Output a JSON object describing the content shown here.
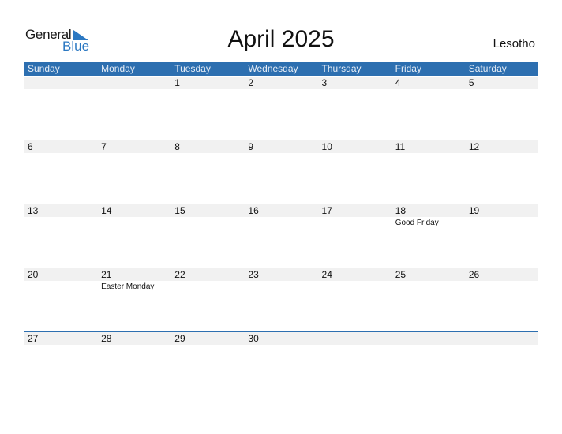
{
  "logo": {
    "line1": "General",
    "line2": "Blue"
  },
  "title": "April 2025",
  "country": "Lesotho",
  "colors": {
    "accent": "#2d6fb0",
    "strip": "#f1f1f1",
    "logo_blue": "#2b78c2"
  },
  "weekdays": [
    "Sunday",
    "Monday",
    "Tuesday",
    "Wednesday",
    "Thursday",
    "Friday",
    "Saturday"
  ],
  "weeks": [
    [
      {
        "d": ""
      },
      {
        "d": ""
      },
      {
        "d": "1"
      },
      {
        "d": "2"
      },
      {
        "d": "3"
      },
      {
        "d": "4"
      },
      {
        "d": "5"
      }
    ],
    [
      {
        "d": "6"
      },
      {
        "d": "7"
      },
      {
        "d": "8"
      },
      {
        "d": "9"
      },
      {
        "d": "10"
      },
      {
        "d": "11"
      },
      {
        "d": "12"
      }
    ],
    [
      {
        "d": "13"
      },
      {
        "d": "14"
      },
      {
        "d": "15"
      },
      {
        "d": "16"
      },
      {
        "d": "17"
      },
      {
        "d": "18",
        "e": "Good Friday"
      },
      {
        "d": "19"
      }
    ],
    [
      {
        "d": "20"
      },
      {
        "d": "21",
        "e": "Easter Monday"
      },
      {
        "d": "22"
      },
      {
        "d": "23"
      },
      {
        "d": "24"
      },
      {
        "d": "25"
      },
      {
        "d": "26"
      }
    ],
    [
      {
        "d": "27"
      },
      {
        "d": "28"
      },
      {
        "d": "29"
      },
      {
        "d": "30"
      },
      {
        "d": ""
      },
      {
        "d": ""
      },
      {
        "d": ""
      }
    ]
  ]
}
